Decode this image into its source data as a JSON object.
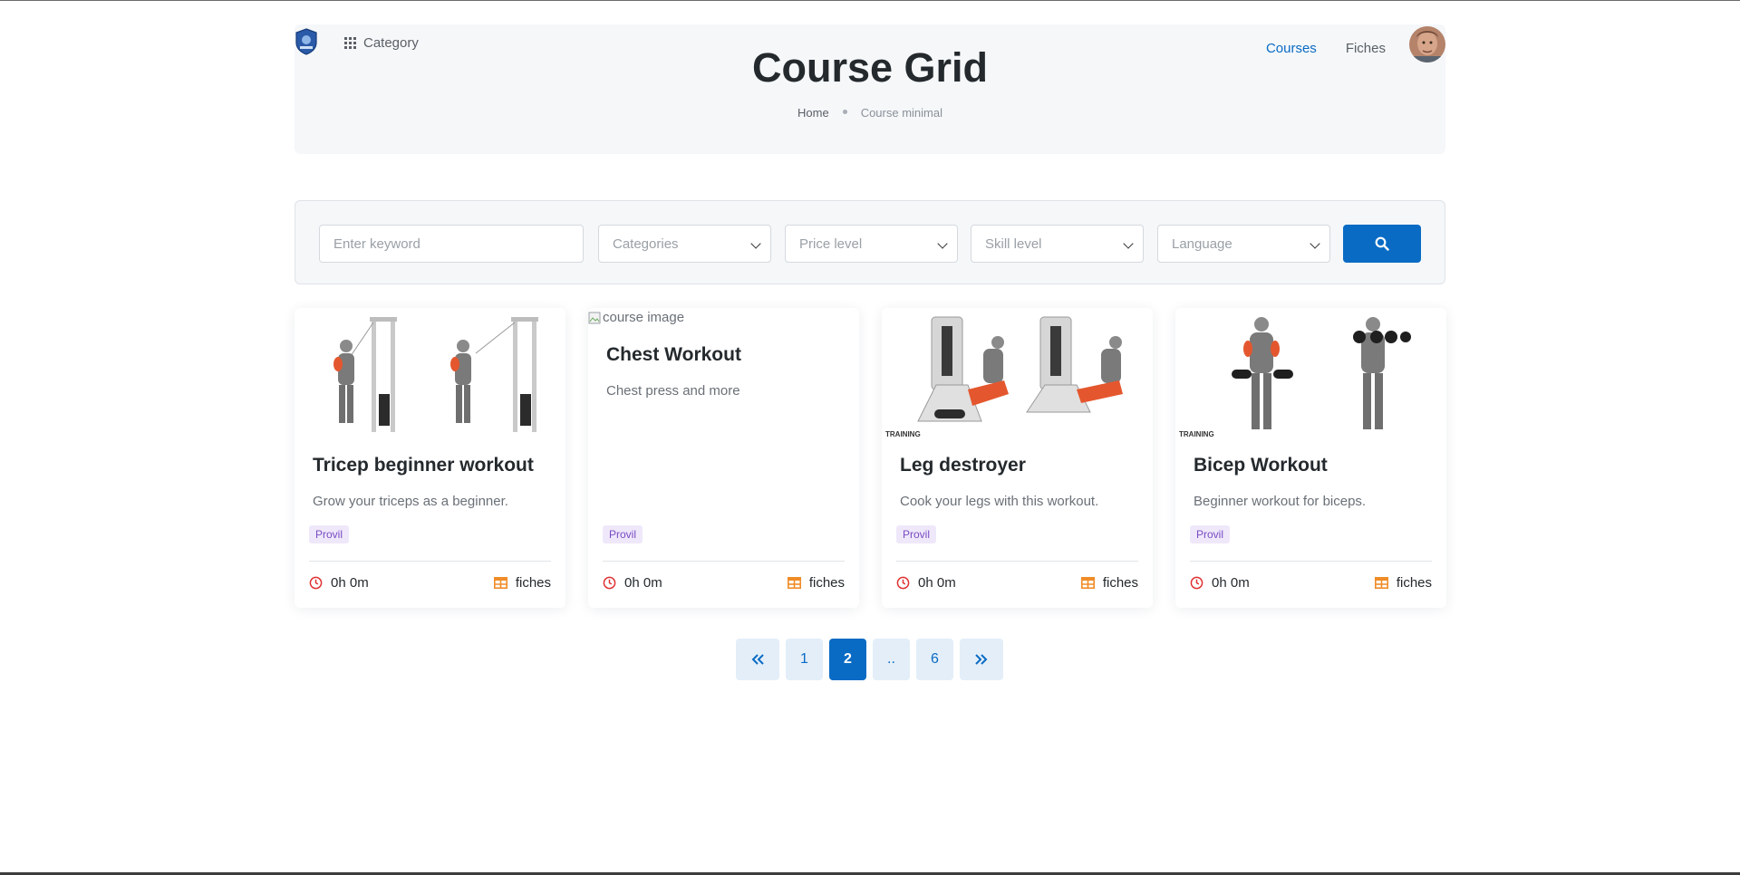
{
  "header": {
    "category_label": "Category",
    "nav": [
      {
        "label": "Courses",
        "active": true
      },
      {
        "label": "Fiches",
        "active": false
      }
    ],
    "title": "Course Grid",
    "breadcrumb": {
      "home": "Home",
      "current": "Course minimal"
    }
  },
  "filters": {
    "keyword_placeholder": "Enter keyword",
    "categories": "Categories",
    "price": "Price level",
    "skill": "Skill level",
    "language": "Language"
  },
  "courses": [
    {
      "title": "Tricep beginner workout",
      "description": "Grow your triceps as a beginner.",
      "tag": "Provil",
      "duration": "0h 0m",
      "fiches": "fiches"
    },
    {
      "title": "Chest Workout",
      "description": "Chest press and more",
      "tag": "Provil",
      "duration": "0h 0m",
      "fiches": "fiches",
      "image_alt": "course image"
    },
    {
      "title": "Leg destroyer",
      "description": "Cook your legs with this workout.",
      "tag": "Provil",
      "duration": "0h 0m",
      "fiches": "fiches"
    },
    {
      "title": "Bicep Workout",
      "description": "Beginner workout for biceps.",
      "tag": "Provil",
      "duration": "0h 0m",
      "fiches": "fiches"
    }
  ],
  "pagination": {
    "pages": [
      "1",
      "2",
      "..",
      "6"
    ],
    "current": "2"
  },
  "colors": {
    "primary": "#0a6bc4",
    "tag_bg": "#efe8fa",
    "tag_text": "#7a4bc4",
    "clock": "#e03131",
    "fiches_icon": "#f08c28"
  }
}
